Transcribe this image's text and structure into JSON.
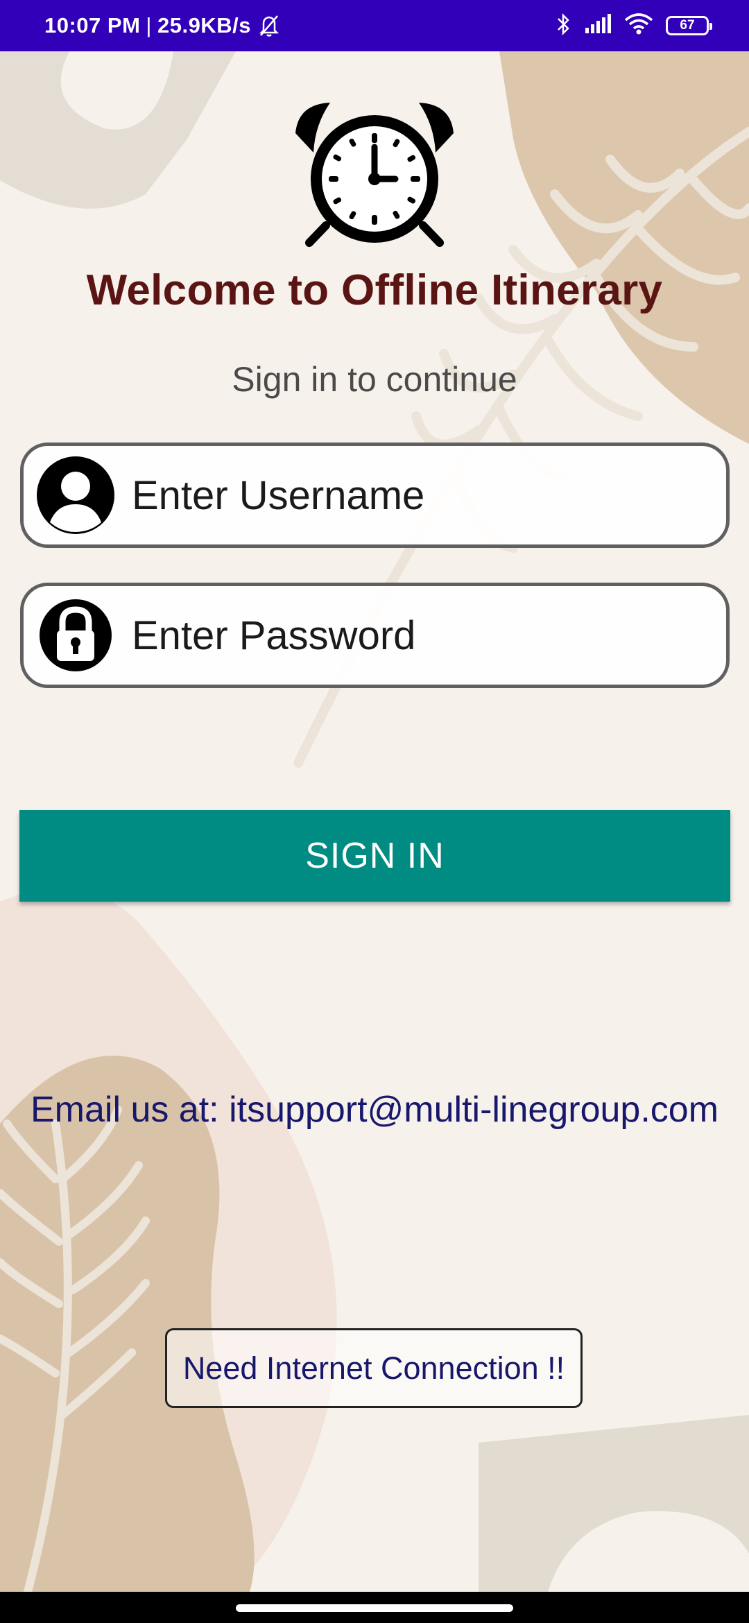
{
  "status_bar": {
    "time": "10:07 PM",
    "separator": "|",
    "network_speed": "25.9KB/s",
    "battery_level": "67",
    "icons": [
      "bell-off-icon",
      "bluetooth-icon",
      "signal-icon",
      "wifi-icon",
      "battery-icon"
    ]
  },
  "app": {
    "logo_icon": "alarm-clock-icon",
    "title": "Welcome to Offline Itinerary",
    "subtitle": "Sign in to continue"
  },
  "form": {
    "username_placeholder": "Enter Username",
    "username_icon": "user-avatar-icon",
    "password_placeholder": "Enter Password",
    "password_icon": "padlock-icon",
    "signin_label": "SIGN IN"
  },
  "footer": {
    "email_text": "Email us at: itsupport@multi-linegroup.com",
    "internet_notice": "Need Internet Connection !!"
  },
  "colors": {
    "status_bar": "#3200b8",
    "title": "#5a1414",
    "button": "#008b83",
    "email_text": "#17176b",
    "background": "#f6f1eb"
  }
}
